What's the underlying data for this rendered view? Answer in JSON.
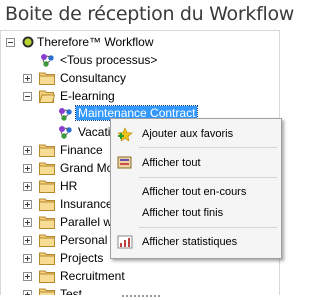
{
  "title": "Boite de réception du Workflow",
  "tree": {
    "root": "Therefore™ Workflow",
    "all_processes": "<Tous processus>",
    "consultancy": "Consultancy",
    "elearning": "E-learning",
    "maintenance": "Maintenance Contract",
    "vacation": "Vacati",
    "finance": "Finance",
    "grandmo": "Grand Mo",
    "hr": "HR",
    "insurance": "Insurance",
    "parallel": "Parallel w",
    "personal": "Personal",
    "projects": "Projects",
    "recruitment": "Recruitment",
    "test": "Test"
  },
  "context_menu": {
    "add_favorites": "Ajouter aux favoris",
    "show_all": "Afficher tout",
    "show_in_progress": "Afficher tout en-cours",
    "show_finished": "Afficher tout finis",
    "show_stats": "Afficher statistiques"
  }
}
